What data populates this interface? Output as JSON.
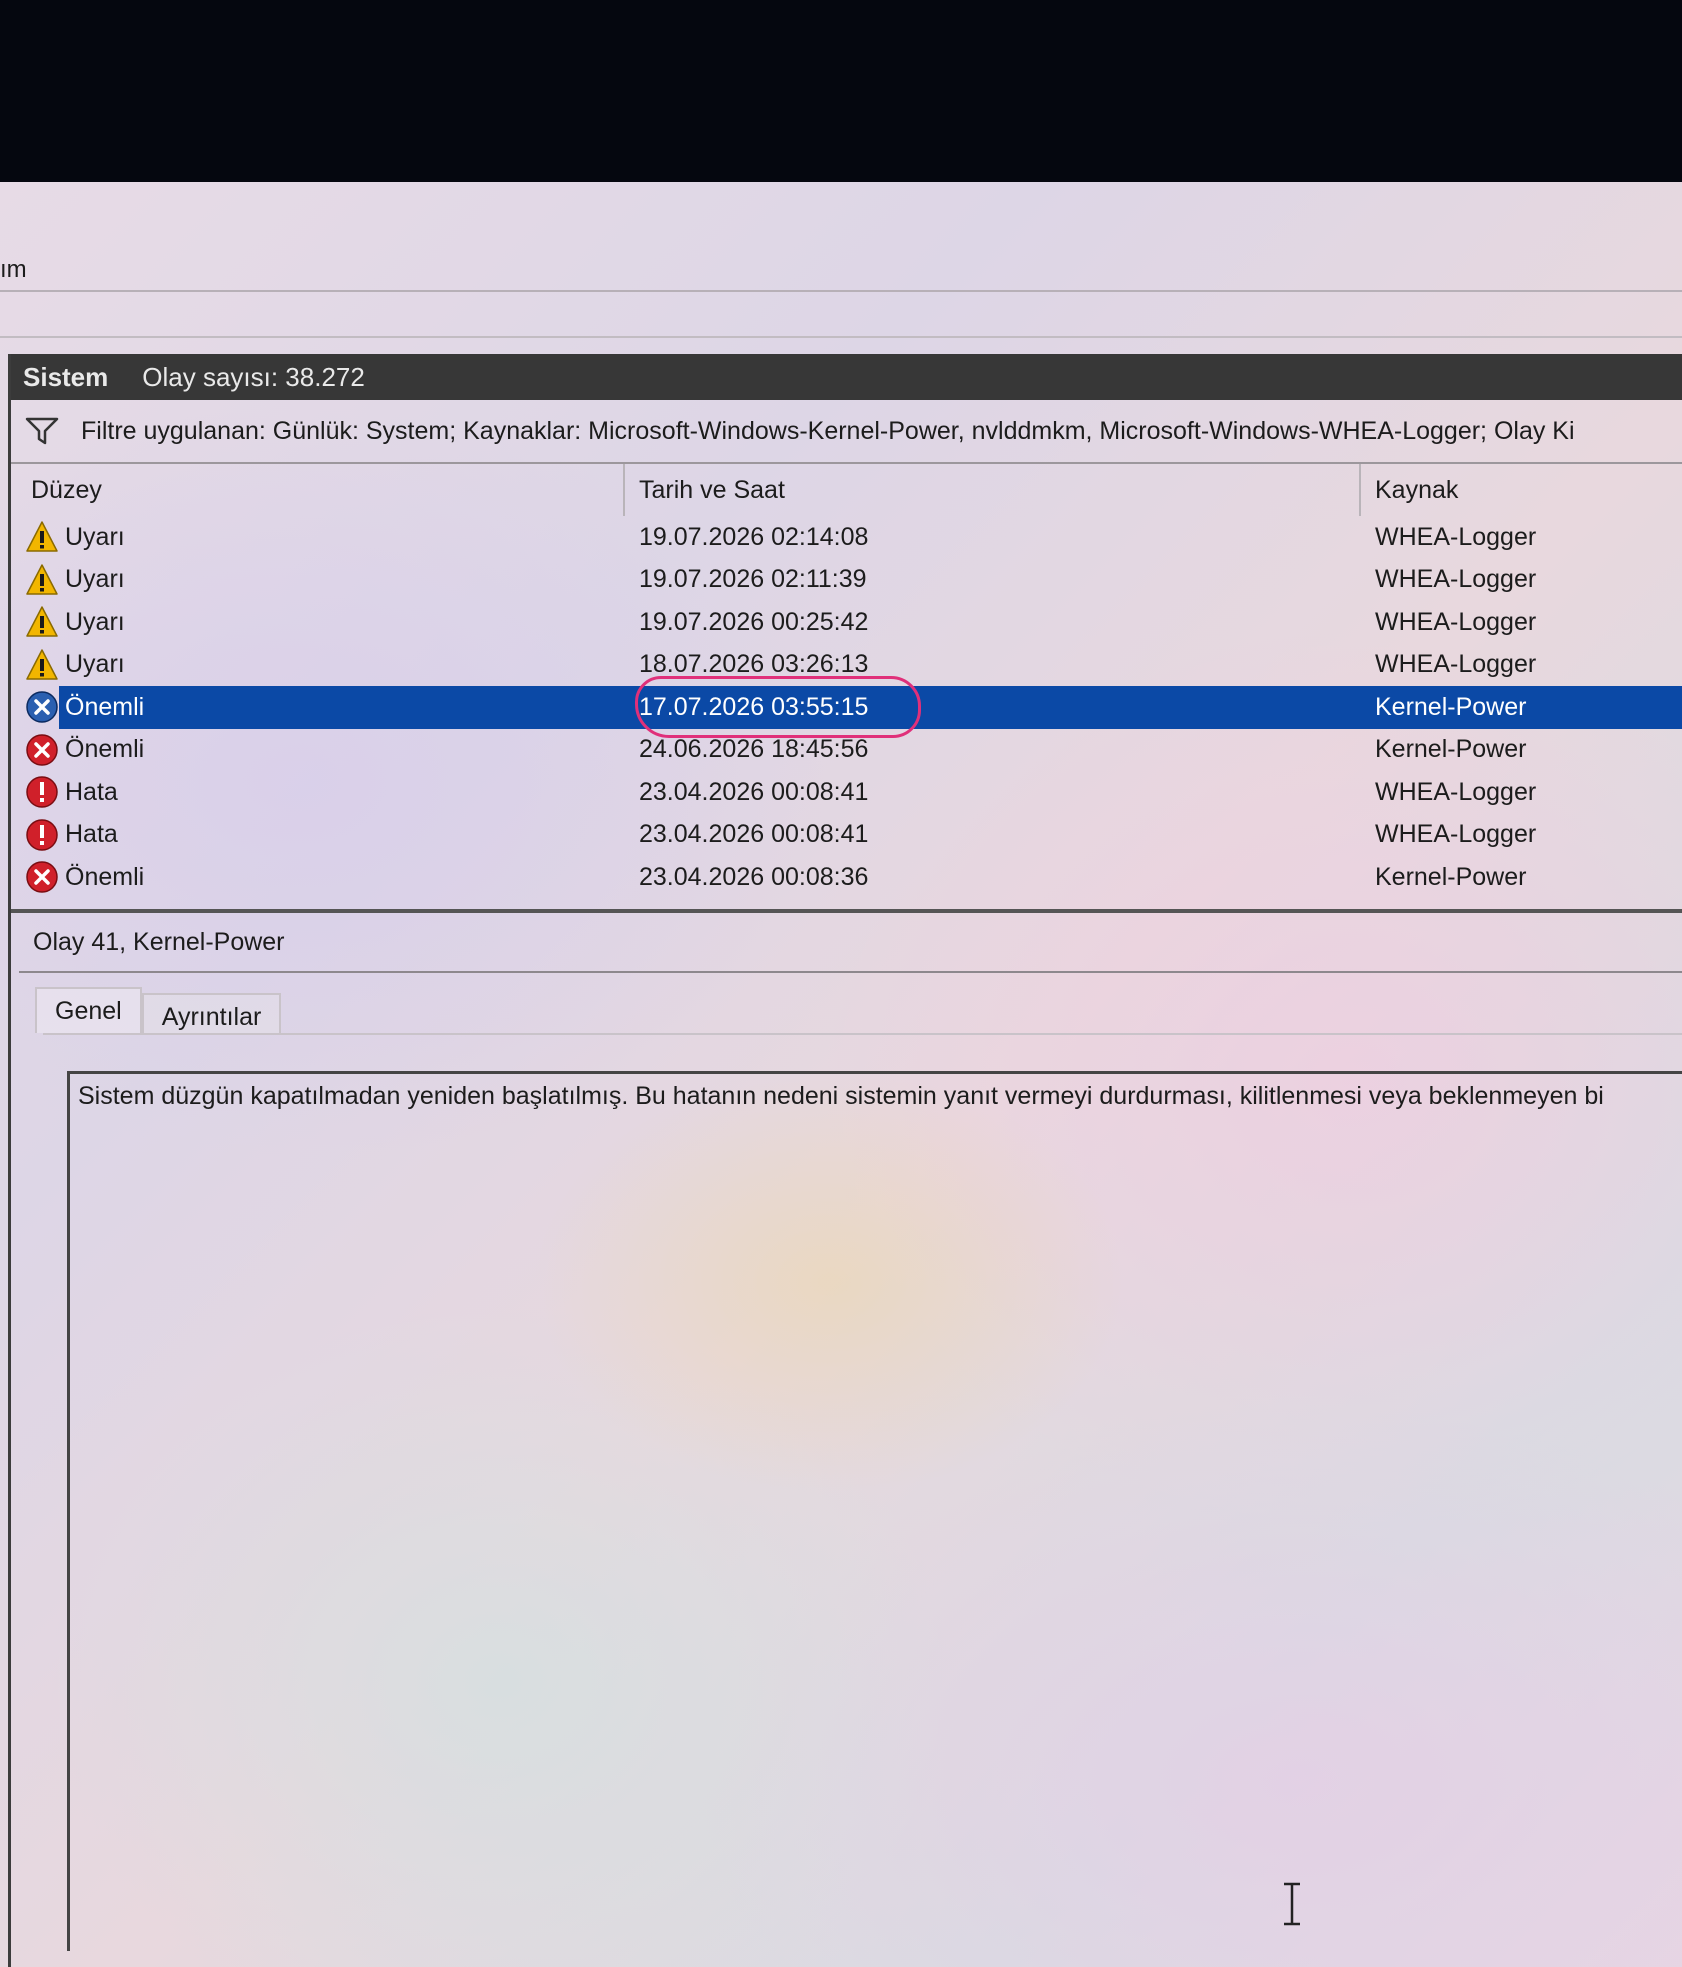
{
  "menu": {
    "partial_label": "ım"
  },
  "panel": {
    "title": "Sistem",
    "event_count": "Olay sayısı: 38.272"
  },
  "filter": {
    "text": "Filtre uygulanan: Günlük: System; Kaynaklar: Microsoft-Windows-Kernel-Power, nvlddmkm, Microsoft-Windows-WHEA-Logger; Olay Ki"
  },
  "columns": {
    "level": "Düzey",
    "date": "Tarih ve Saat",
    "source": "Kaynak"
  },
  "events": [
    {
      "level": "Uyarı",
      "icon": "warning-icon",
      "date": "19.07.2026 02:14:08",
      "source": "WHEA-Logger"
    },
    {
      "level": "Uyarı",
      "icon": "warning-icon",
      "date": "19.07.2026 02:11:39",
      "source": "WHEA-Logger"
    },
    {
      "level": "Uyarı",
      "icon": "warning-icon",
      "date": "19.07.2026 00:25:42",
      "source": "WHEA-Logger"
    },
    {
      "level": "Uyarı",
      "icon": "warning-icon",
      "date": "18.07.2026 03:26:13",
      "source": "WHEA-Logger"
    },
    {
      "level": "Önemli",
      "icon": "critical-icon",
      "date": "17.07.2026 03:55:15",
      "source": "Kernel-Power",
      "selected": true
    },
    {
      "level": "Önemli",
      "icon": "critical-icon",
      "date": "24.06.2026 18:45:56",
      "source": "Kernel-Power"
    },
    {
      "level": "Hata",
      "icon": "error-icon",
      "date": "23.04.2026 00:08:41",
      "source": "WHEA-Logger"
    },
    {
      "level": "Hata",
      "icon": "error-icon",
      "date": "23.04.2026 00:08:41",
      "source": "WHEA-Logger"
    },
    {
      "level": "Önemli",
      "icon": "critical-icon",
      "date": "23.04.2026 00:08:36",
      "source": "Kernel-Power"
    }
  ],
  "details": {
    "title": "Olay 41, Kernel-Power",
    "tabs": [
      "Genel",
      "Ayrıntılar"
    ],
    "description": "Sistem düzgün kapatılmadan yeniden başlatılmış. Bu hatanın nedeni sistemin yanıt vermeyi durdurması, kilitlenmesi veya beklenmeyen bi"
  },
  "colors": {
    "selection": "#0b49a6",
    "header_bar": "#373737",
    "annotation": "#e0307a",
    "warning": "#f2b600",
    "error": "#d0202a"
  }
}
